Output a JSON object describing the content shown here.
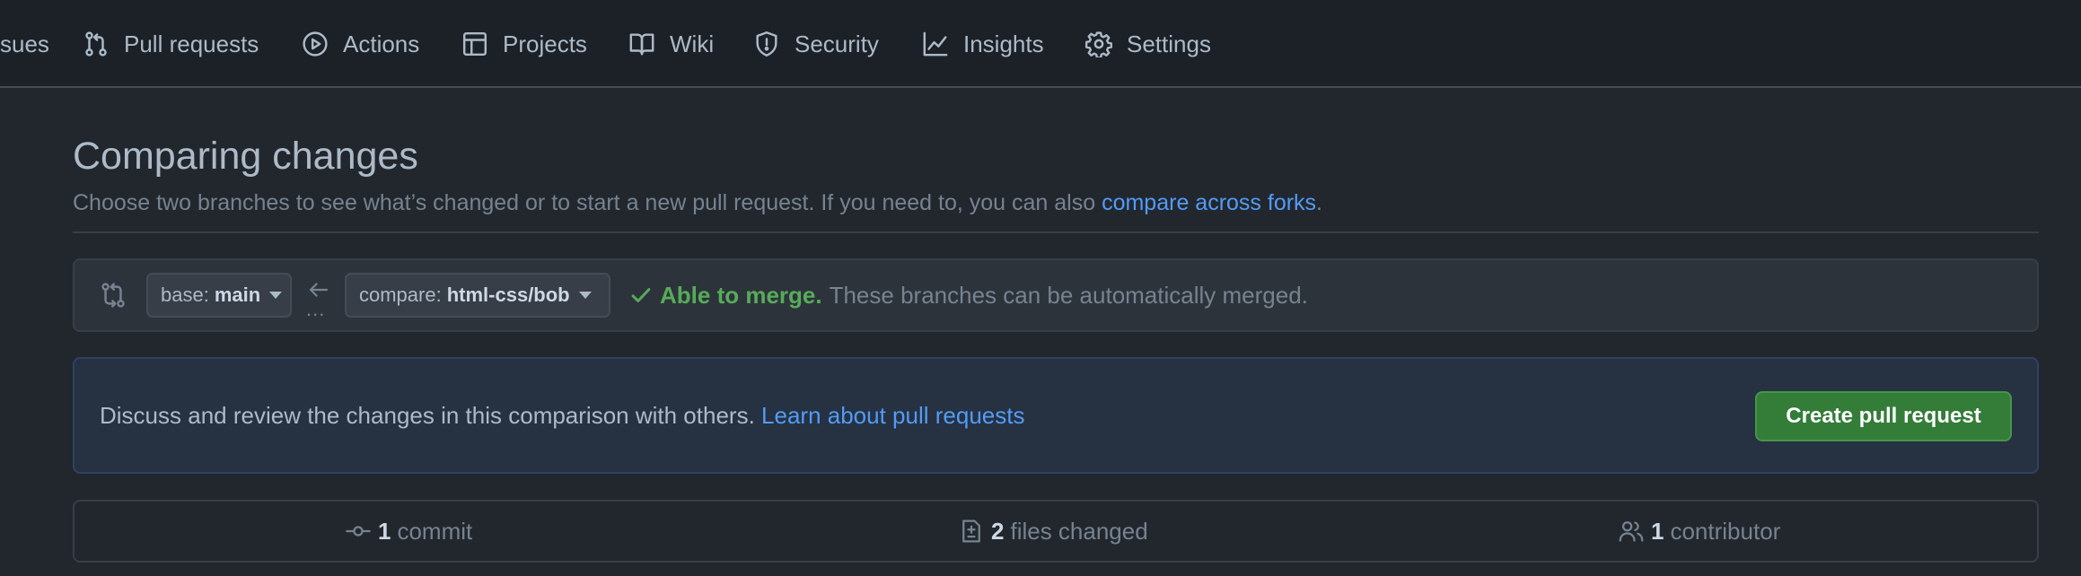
{
  "nav": {
    "items": [
      {
        "label": "sues",
        "icon": "issue-icon"
      },
      {
        "label": "Pull requests",
        "icon": "pull-request-icon"
      },
      {
        "label": "Actions",
        "icon": "play-icon"
      },
      {
        "label": "Projects",
        "icon": "table-icon"
      },
      {
        "label": "Wiki",
        "icon": "book-icon"
      },
      {
        "label": "Security",
        "icon": "shield-icon"
      },
      {
        "label": "Insights",
        "icon": "graph-icon"
      },
      {
        "label": "Settings",
        "icon": "gear-icon"
      }
    ]
  },
  "header": {
    "title": "Comparing changes",
    "description": "Choose two branches to see what’s changed or to start a new pull request. If you need to, you can also",
    "link": "compare across forks",
    "trailing": "."
  },
  "range": {
    "icon": "git-compare-icon",
    "base_prefix": "base:",
    "base_branch": "main",
    "arrow_icon": "arrow-left-icon",
    "dots": "...",
    "compare_prefix": "compare:",
    "compare_branch": "html-css/bob",
    "merge_icon": "check-icon",
    "merge_status": "Able to merge.",
    "merge_message": "These branches can be automatically merged."
  },
  "discuss": {
    "text": "Discuss and review the changes in this comparison with others.",
    "link": "Learn about pull requests",
    "button": "Create pull request"
  },
  "summary": {
    "commits": {
      "count": "1",
      "label": "commit",
      "icon": "git-commit-icon"
    },
    "files": {
      "count": "2",
      "label": "files changed",
      "icon": "file-diff-icon"
    },
    "contributors": {
      "count": "1",
      "label": "contributor",
      "icon": "people-icon"
    }
  },
  "colors": {
    "background": "#22272e",
    "nav_background": "#1c2128",
    "accent_link": "#539bf5",
    "success": "#57ab5a",
    "primary_button": "#347d39"
  }
}
